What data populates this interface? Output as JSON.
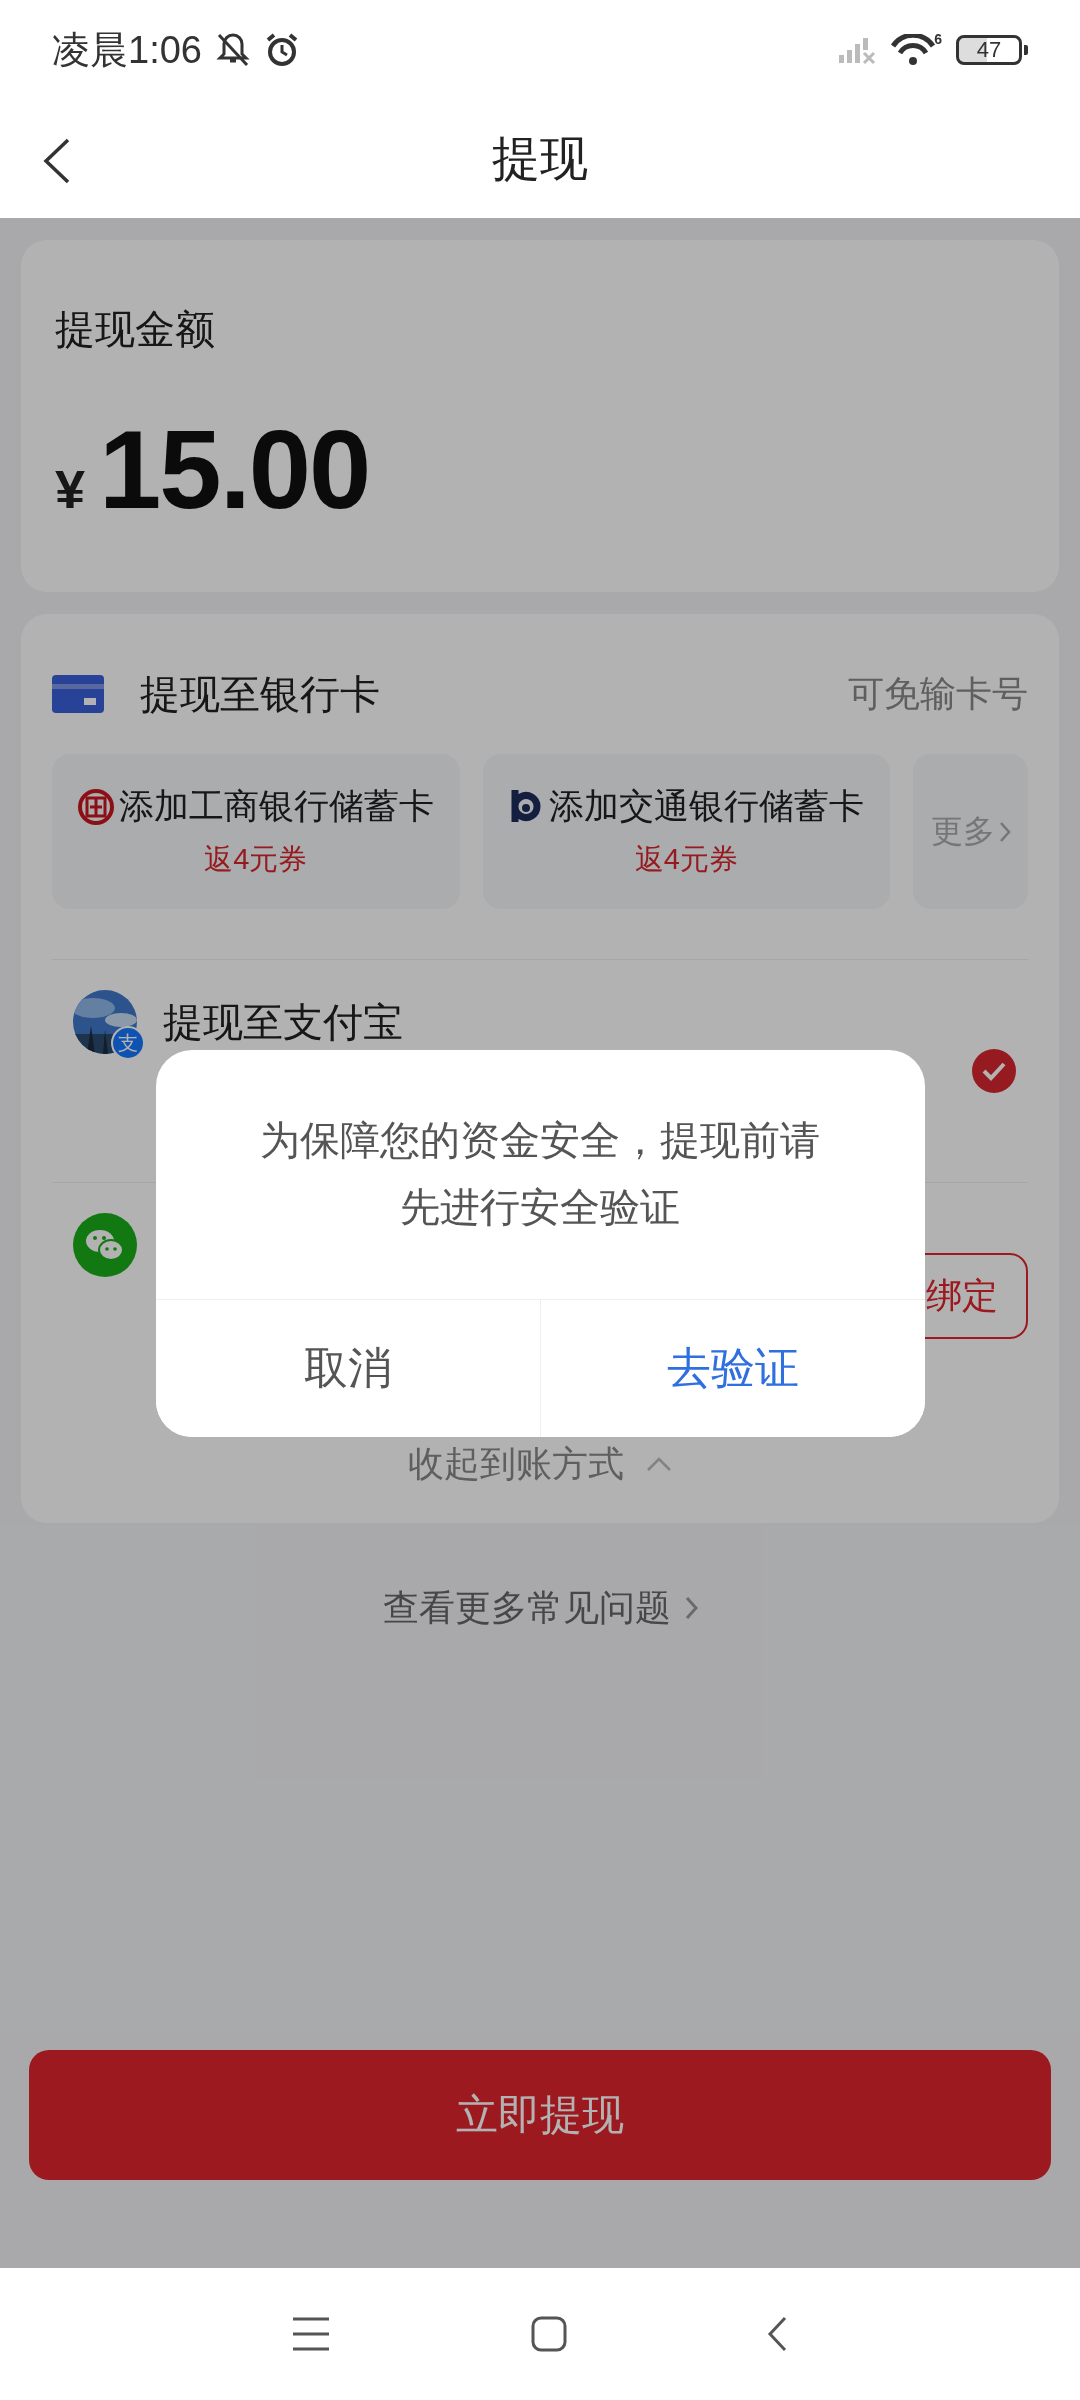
{
  "status_bar": {
    "time": "凌晨1:06",
    "network_type": "6",
    "battery": "47"
  },
  "header": {
    "title": "提现"
  },
  "amount_card": {
    "label": "提现金额",
    "currency": "¥",
    "amount": "15.00"
  },
  "bank_section": {
    "title": "提现至银行卡",
    "hint": "可免输卡号",
    "banks": [
      {
        "kind": "icbc",
        "name": "添加工商银行储蓄卡",
        "promo": "返4元券"
      },
      {
        "kind": "bocom",
        "name": "添加交通银行储蓄卡",
        "promo": "返4元券"
      }
    ],
    "more": "更多"
  },
  "methods": [
    {
      "kind": "alipay",
      "title": "提现至支付宝",
      "badge": "支",
      "selected": true
    },
    {
      "kind": "wechat",
      "action": "绑定",
      "selected": false
    }
  ],
  "collapse": "收起到账方式",
  "faq": "查看更多常见问题",
  "submit": "立即提现",
  "dialog": {
    "message": "为保障您的资金安全，提现前请先进行安全验证",
    "buttons": [
      {
        "kind": "cancel",
        "label": "取消"
      },
      {
        "kind": "confirm",
        "label": "去验证"
      }
    ]
  }
}
